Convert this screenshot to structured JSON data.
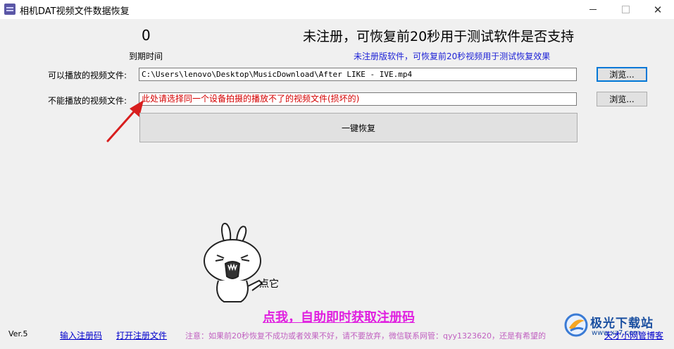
{
  "window": {
    "title": "相机DAT视频文件数据恢复",
    "minimize_glyph": "—",
    "maximize_glyph": "☐",
    "close_glyph": "✕"
  },
  "status": {
    "counter": "0",
    "main_text": "未注册，可恢复前20秒用于测试软件是否支持",
    "expiry_label": "到期时间",
    "sub_text": "未注册版软件，可恢复前20秒视频用于测试恢复效果"
  },
  "playable": {
    "label": "可以播放的视频文件:",
    "value": "C:\\Users\\lenovo\\Desktop\\MusicDownload\\After  LIKE - IVE.mp4",
    "browse_label": "浏览..."
  },
  "broken": {
    "label": "不能播放的视频文件:",
    "value": "此处请选择同一个设备拍摄的播放不了的视频文件(损坏的)",
    "browse_label": "浏览..."
  },
  "actions": {
    "recover_label": "一键恢复"
  },
  "mascot": {
    "caption": "点它"
  },
  "promo": {
    "link_text": "点我，自助即时获取注册码"
  },
  "footer": {
    "version": "Ver.5",
    "enter_code": "输入注册码",
    "open_file": "打开注册文件",
    "notice": "注意：如果前20秒恢复不成功或者效果不好，请不要放弃，微信联系网管：qyy1323620，还是有希望的",
    "blog": "天才小网管博客"
  },
  "watermark": {
    "name": "极光下载站",
    "url": "www.xz7.com"
  },
  "colors": {
    "accent_blue": "#1e22d6",
    "warning_red": "#d40000",
    "promo_magenta": "#e020e0",
    "notice_pink": "#c060c0"
  }
}
